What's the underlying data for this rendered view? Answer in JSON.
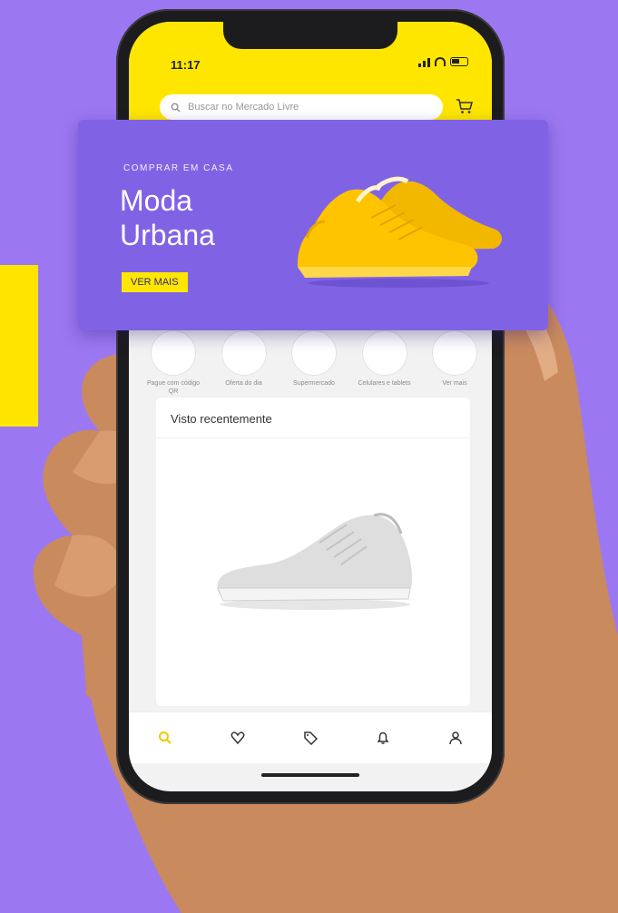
{
  "status_bar": {
    "time": "11:17"
  },
  "search": {
    "placeholder": "Buscar no Mercado Livre"
  },
  "banner": {
    "eyebrow": "COMPRAR EM CASA",
    "title_line1": "Moda",
    "title_line2": "Urbana",
    "cta_label": "VER MAIS"
  },
  "categories": [
    {
      "label": "Pague com código QR"
    },
    {
      "label": "Oferta do dia"
    },
    {
      "label": "Supermercado"
    },
    {
      "label": "Celulares e tablets"
    },
    {
      "label": "Ver mais"
    }
  ],
  "recent": {
    "title": "Visto recentemente"
  },
  "bottom_nav": [
    "search-icon",
    "heart-icon",
    "tag-icon",
    "bell-icon",
    "user-icon"
  ],
  "colors": {
    "background": "#9b78f2",
    "accent_yellow": "#ffe600",
    "banner": "#8063e5"
  }
}
